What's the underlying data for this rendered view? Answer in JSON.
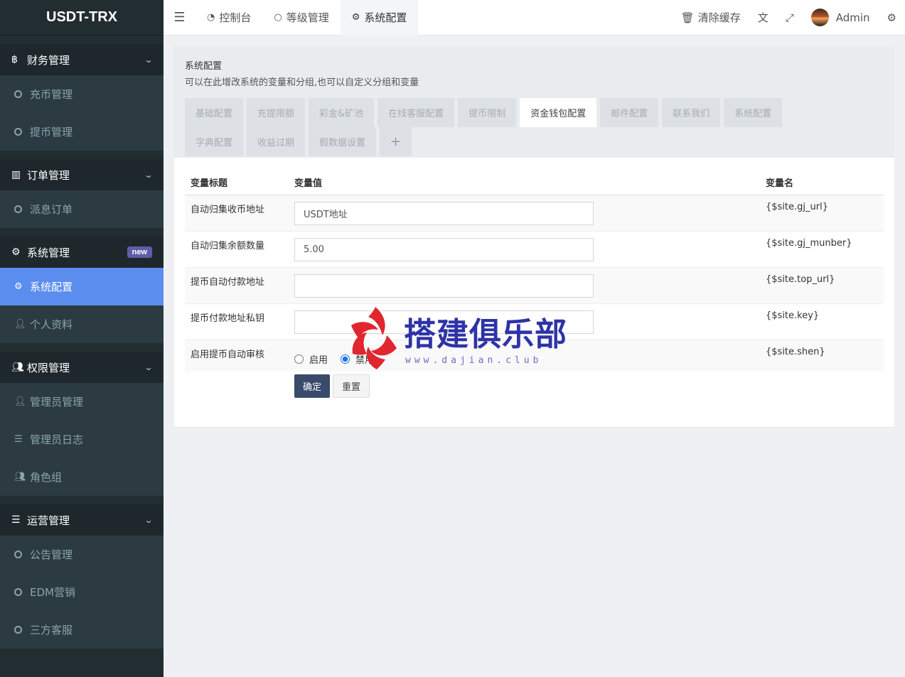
{
  "app": {
    "logo": "USDT-TRX"
  },
  "sidebar": {
    "groups": [
      {
        "label": "财务管理",
        "icon": "bitcoin-icon",
        "items": [
          {
            "label": "充币管理"
          },
          {
            "label": "提币管理"
          }
        ]
      },
      {
        "label": "订单管理",
        "icon": "bar-chart-icon",
        "items": [
          {
            "label": "派息订单"
          }
        ]
      },
      {
        "label": "系统管理",
        "icon": "gears-icon",
        "badge": "new",
        "items": [
          {
            "label": "系统配置",
            "active": true
          },
          {
            "label": "个人资料"
          }
        ]
      },
      {
        "label": "权限管理",
        "icon": "users-icon",
        "items": [
          {
            "label": "管理员管理"
          },
          {
            "label": "管理员日志"
          },
          {
            "label": "角色组"
          }
        ]
      },
      {
        "label": "运营管理",
        "icon": "list-icon",
        "items": [
          {
            "label": "公告管理"
          },
          {
            "label": "EDM营销"
          },
          {
            "label": "三方客服"
          }
        ]
      }
    ]
  },
  "topnav": {
    "tabs": [
      {
        "label": "控制台",
        "icon": "dashboard-icon"
      },
      {
        "label": "等级管理",
        "icon": "circle-icon"
      },
      {
        "label": "系统配置",
        "icon": "gear-icon",
        "active": true
      }
    ],
    "clear_cache": "清除缓存",
    "user": "Admin"
  },
  "panel": {
    "title": "系统配置",
    "description": "可以在此增改系统的变量和分组,也可以自定义分组和变量",
    "tabs_row1": [
      "基础配置",
      "充提限额",
      "彩金&矿池",
      "在线客服配置",
      "提币限制",
      "资金钱包配置",
      "邮件配置",
      "联系我们",
      "系统配置"
    ],
    "tabs_row2": [
      "字典配置",
      "收益过期",
      "假数据设置"
    ],
    "active_tab": "资金钱包配置",
    "table": {
      "headers": {
        "title": "变量标题",
        "value": "变量值",
        "name": "变量名"
      },
      "rows": [
        {
          "title": "自动归集收币地址",
          "value": "USDT地址",
          "name": "{$site.gj_url}"
        },
        {
          "title": "自动归集余额数量",
          "value": "5.00",
          "name": "{$site.gj_munber}"
        },
        {
          "title": "提币自动付款地址",
          "value": "",
          "name": "{$site.top_url}"
        },
        {
          "title": "提币付款地址私钥",
          "value": "",
          "name": "{$site.key}"
        },
        {
          "title": "启用提币自动审核",
          "radio_on_label": "启用",
          "radio_off_label": "禁用",
          "selected": "禁用",
          "name": "{$site.shen}"
        }
      ]
    },
    "buttons": {
      "submit": "确定",
      "reset": "重置"
    }
  },
  "watermark": {
    "text": "搭建俱乐部",
    "url": "www.dajian.club"
  }
}
